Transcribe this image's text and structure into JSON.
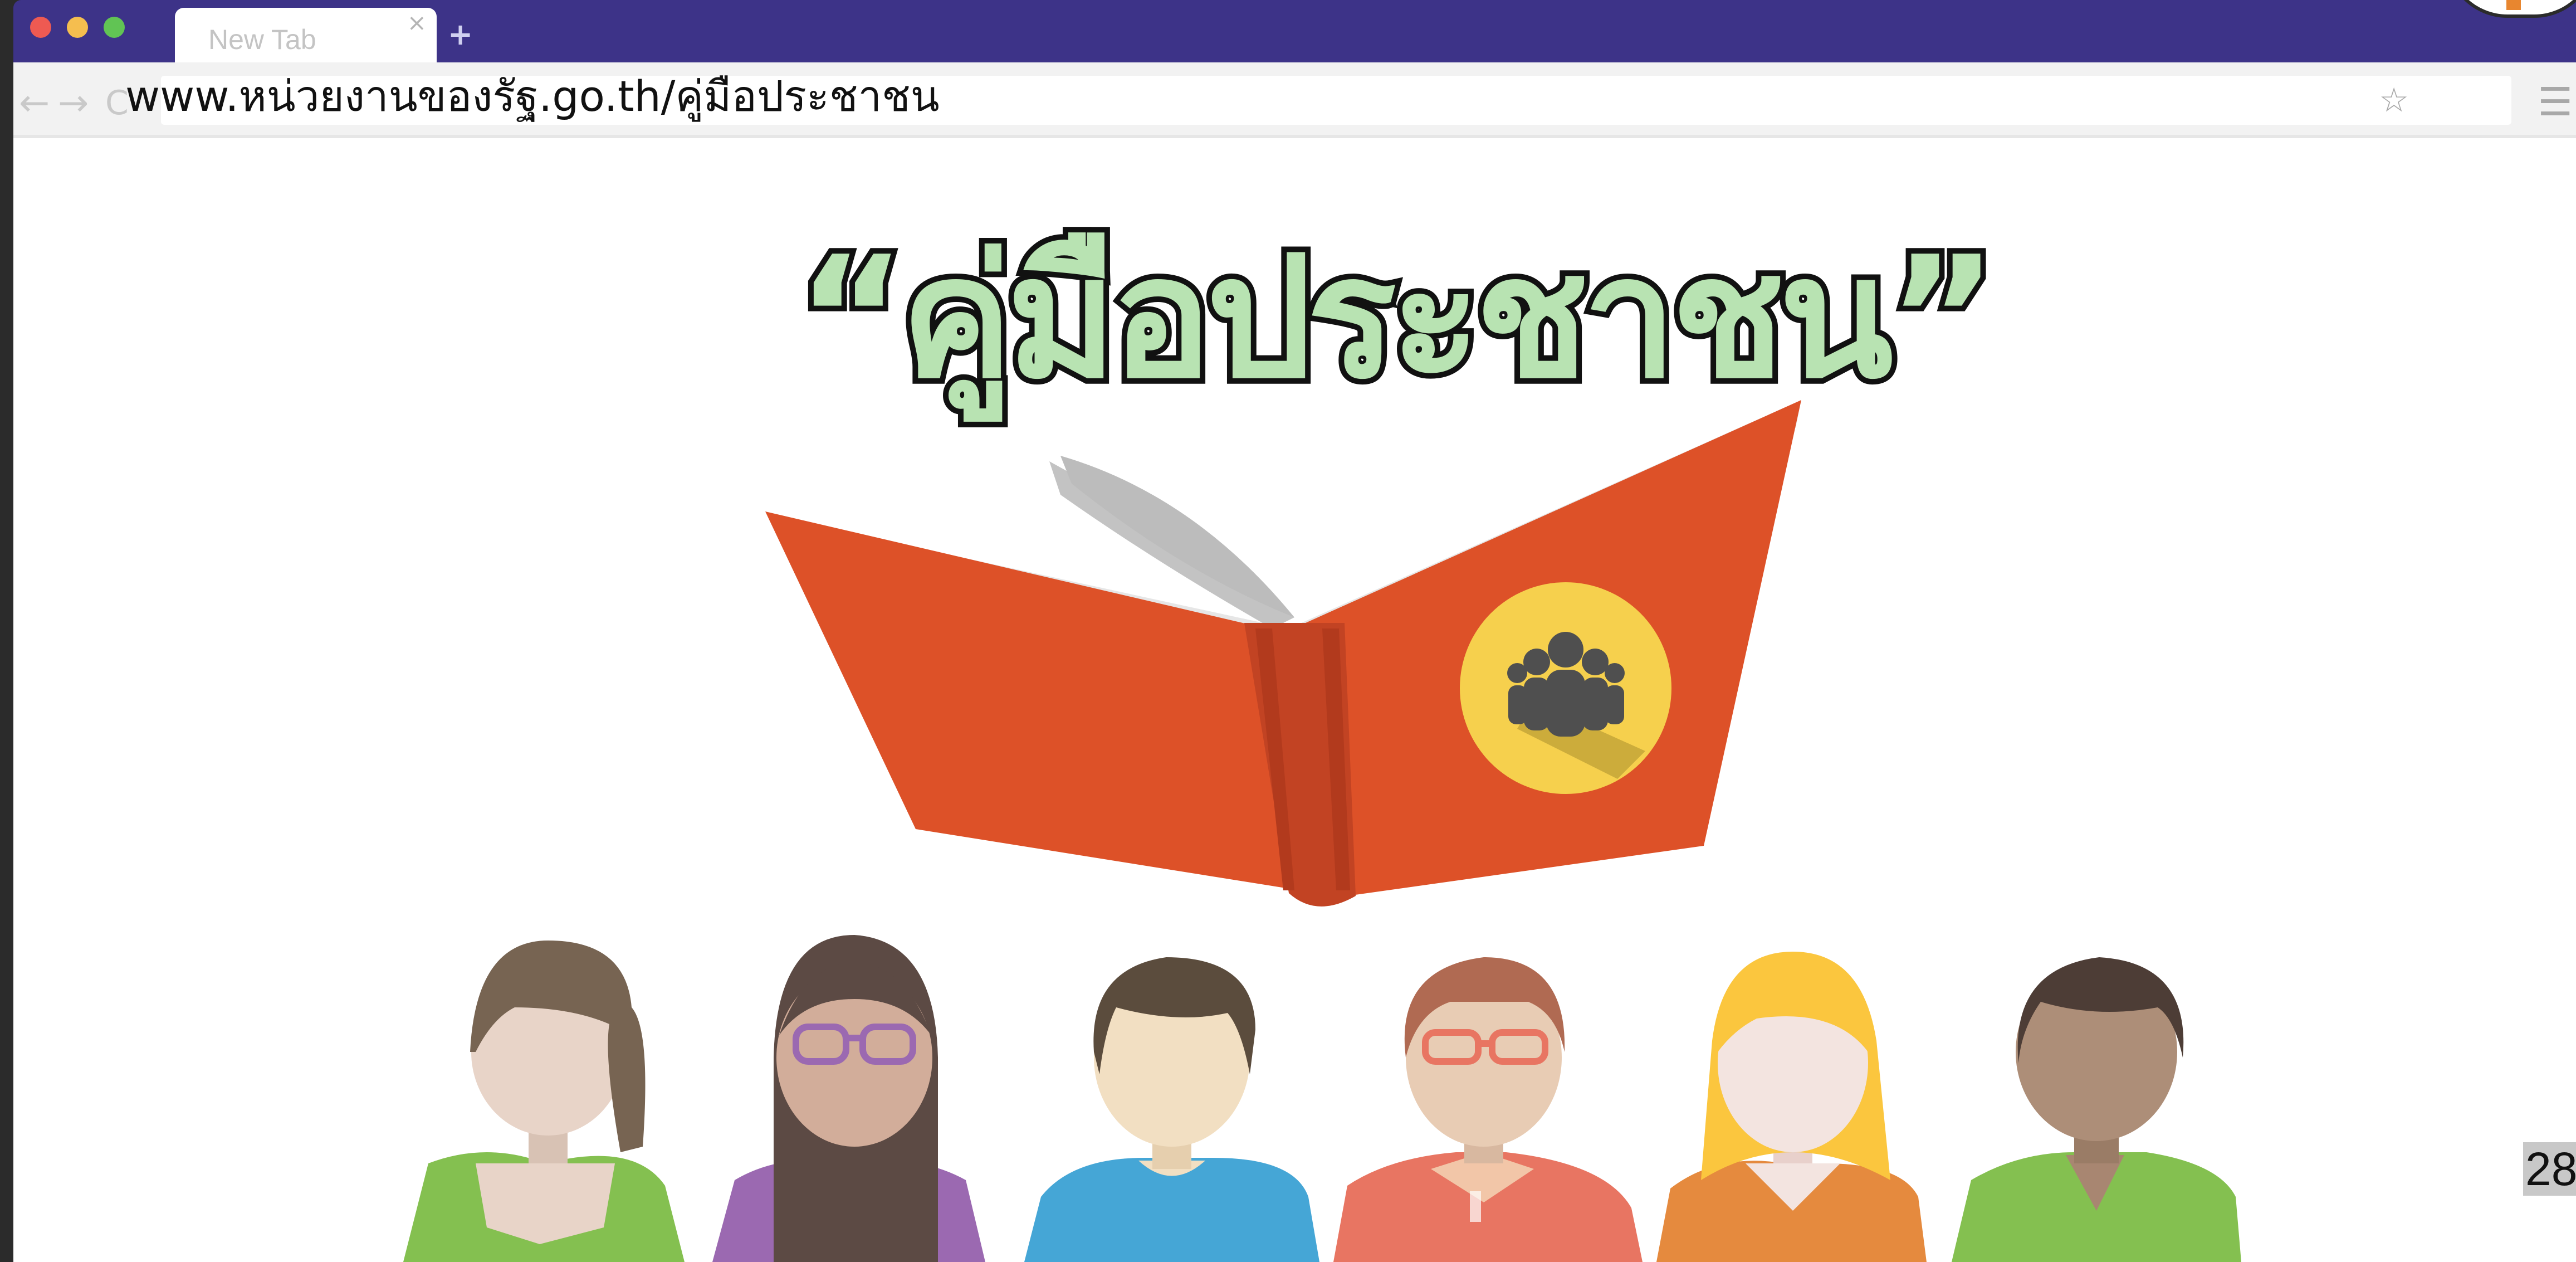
{
  "browser": {
    "tab_title": "New Tab",
    "tab_close_glyph": "×",
    "new_tab_glyph": "+",
    "back_glyph": "←",
    "forward_glyph": "→",
    "reload_glyph": "C",
    "bookmark_glyph": "☆",
    "menu_glyph": "☰",
    "url": "www.หน่วยงานของรัฐ.go.th/คู่มือประชาชน",
    "window_controls": {
      "close_color": "#ee5a52",
      "minimize_color": "#f5be4f",
      "maximize_color": "#61c454"
    },
    "titlebar_color": "#3d3388"
  },
  "slide": {
    "headline": "“คู่มือประชาชน”",
    "page_number": "28",
    "book_color": "#dd5128",
    "badge_color": "#f6d04d",
    "icons": [
      "open-book-icon",
      "people-group-icon",
      "person-avatars"
    ]
  }
}
